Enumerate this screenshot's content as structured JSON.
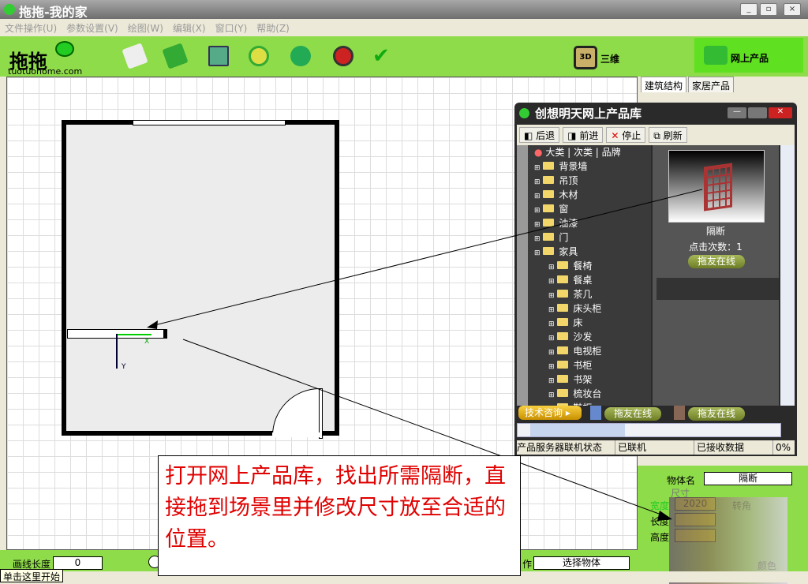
{
  "window": {
    "title": "拖拖-我的家"
  },
  "menu": [
    "文件操作(U)",
    "参数设置(V)",
    "绘图(W)",
    "编辑(X)",
    "窗口(Y)",
    "帮助(Z)"
  ],
  "logo": {
    "text": "tuotuohome.com"
  },
  "toolbar": {
    "three_d_label": "三维",
    "three_d_icon": "3D",
    "online_label": "网上产品"
  },
  "right_tabs": [
    "建筑结构",
    "家居产品"
  ],
  "canvas": {
    "axis_x": "X",
    "axis_y": "Y"
  },
  "popup": {
    "title": "创想明天网上产品库",
    "buttons": [
      "后退",
      "前进",
      "停止",
      "刷新"
    ],
    "tree_header": "大类 | 次类 | 品牌",
    "top_folders": [
      "背景墙",
      "吊顶",
      "木材",
      "窗",
      "油漆",
      "门",
      "家具"
    ],
    "sub_folders": [
      "餐椅",
      "餐桌",
      "茶几",
      "床头柜",
      "床",
      "沙发",
      "电视柜",
      "书柜",
      "书架",
      "梳妆台",
      "鞋柜"
    ],
    "product": {
      "name": "隔断",
      "clicks": "点击次数：1",
      "online": "拖友在线"
    },
    "tech_consult": "技术咨询 ▸",
    "online1": "拖友在线",
    "online2": "拖友在线",
    "status": [
      "产品服务器联机状态",
      "已联机",
      "已接收数据",
      "0%"
    ]
  },
  "props": {
    "name_label": "物体名",
    "name_value": "隔断",
    "size_label": "尺寸",
    "width_label": "宽度",
    "width_value": "2020",
    "length_label": "长度",
    "height_label": "高度",
    "rotate_label": "转角",
    "color_label": "颜色"
  },
  "bottom": {
    "line_length_label": "画线长度",
    "line_length_value": "0",
    "op_label": "作",
    "op_value": "选择物体"
  },
  "status": {
    "start": "单击这里开始"
  },
  "callout": {
    "text": "打开网上产品库，找出所需隔断，直接拖到场景里并修改尺寸放至合适的位置。"
  }
}
